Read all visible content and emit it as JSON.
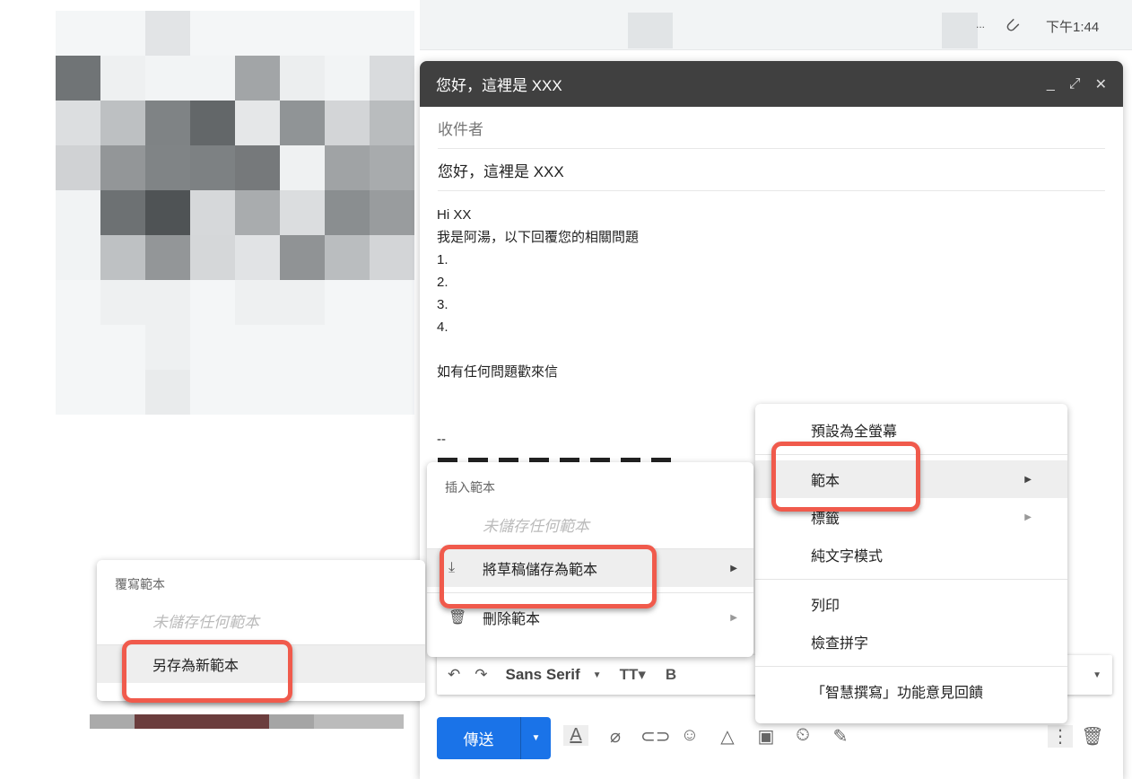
{
  "inbox_row": {
    "ellipsis": "...",
    "time": "下午1:44",
    "attachment_icon": "paperclip-icon"
  },
  "compose": {
    "title": "您好，這裡是 XXX",
    "recipients_placeholder": "收件者",
    "subject": "您好，這裡是 XXX",
    "body_lines": [
      "Hi XX",
      "我是阿湯，以下回覆您的相關問題",
      "1.",
      "2.",
      "3.",
      "4.",
      "",
      "如有任何問題歡來信",
      "",
      "",
      "--"
    ],
    "send_label": "傳送",
    "font_name": "Sans Serif",
    "bold_label": "B"
  },
  "more_menu": {
    "items": [
      "預設為全螢幕",
      "範本",
      "標籤",
      "純文字模式",
      "列印",
      "檢查拼字",
      "「智慧撰寫」功能意見回饋"
    ]
  },
  "template_menu": {
    "header": "插入範本",
    "empty": "未儲存任何範本",
    "save_draft": "將草稿儲存為範本",
    "delete": "刪除範本"
  },
  "save_menu": {
    "header": "覆寫範本",
    "empty": "未儲存任何範本",
    "save_new": "另存為新範本"
  },
  "colors": {
    "send": "#1a73e8",
    "header": "#404040",
    "highlight": "#f05a4c"
  }
}
